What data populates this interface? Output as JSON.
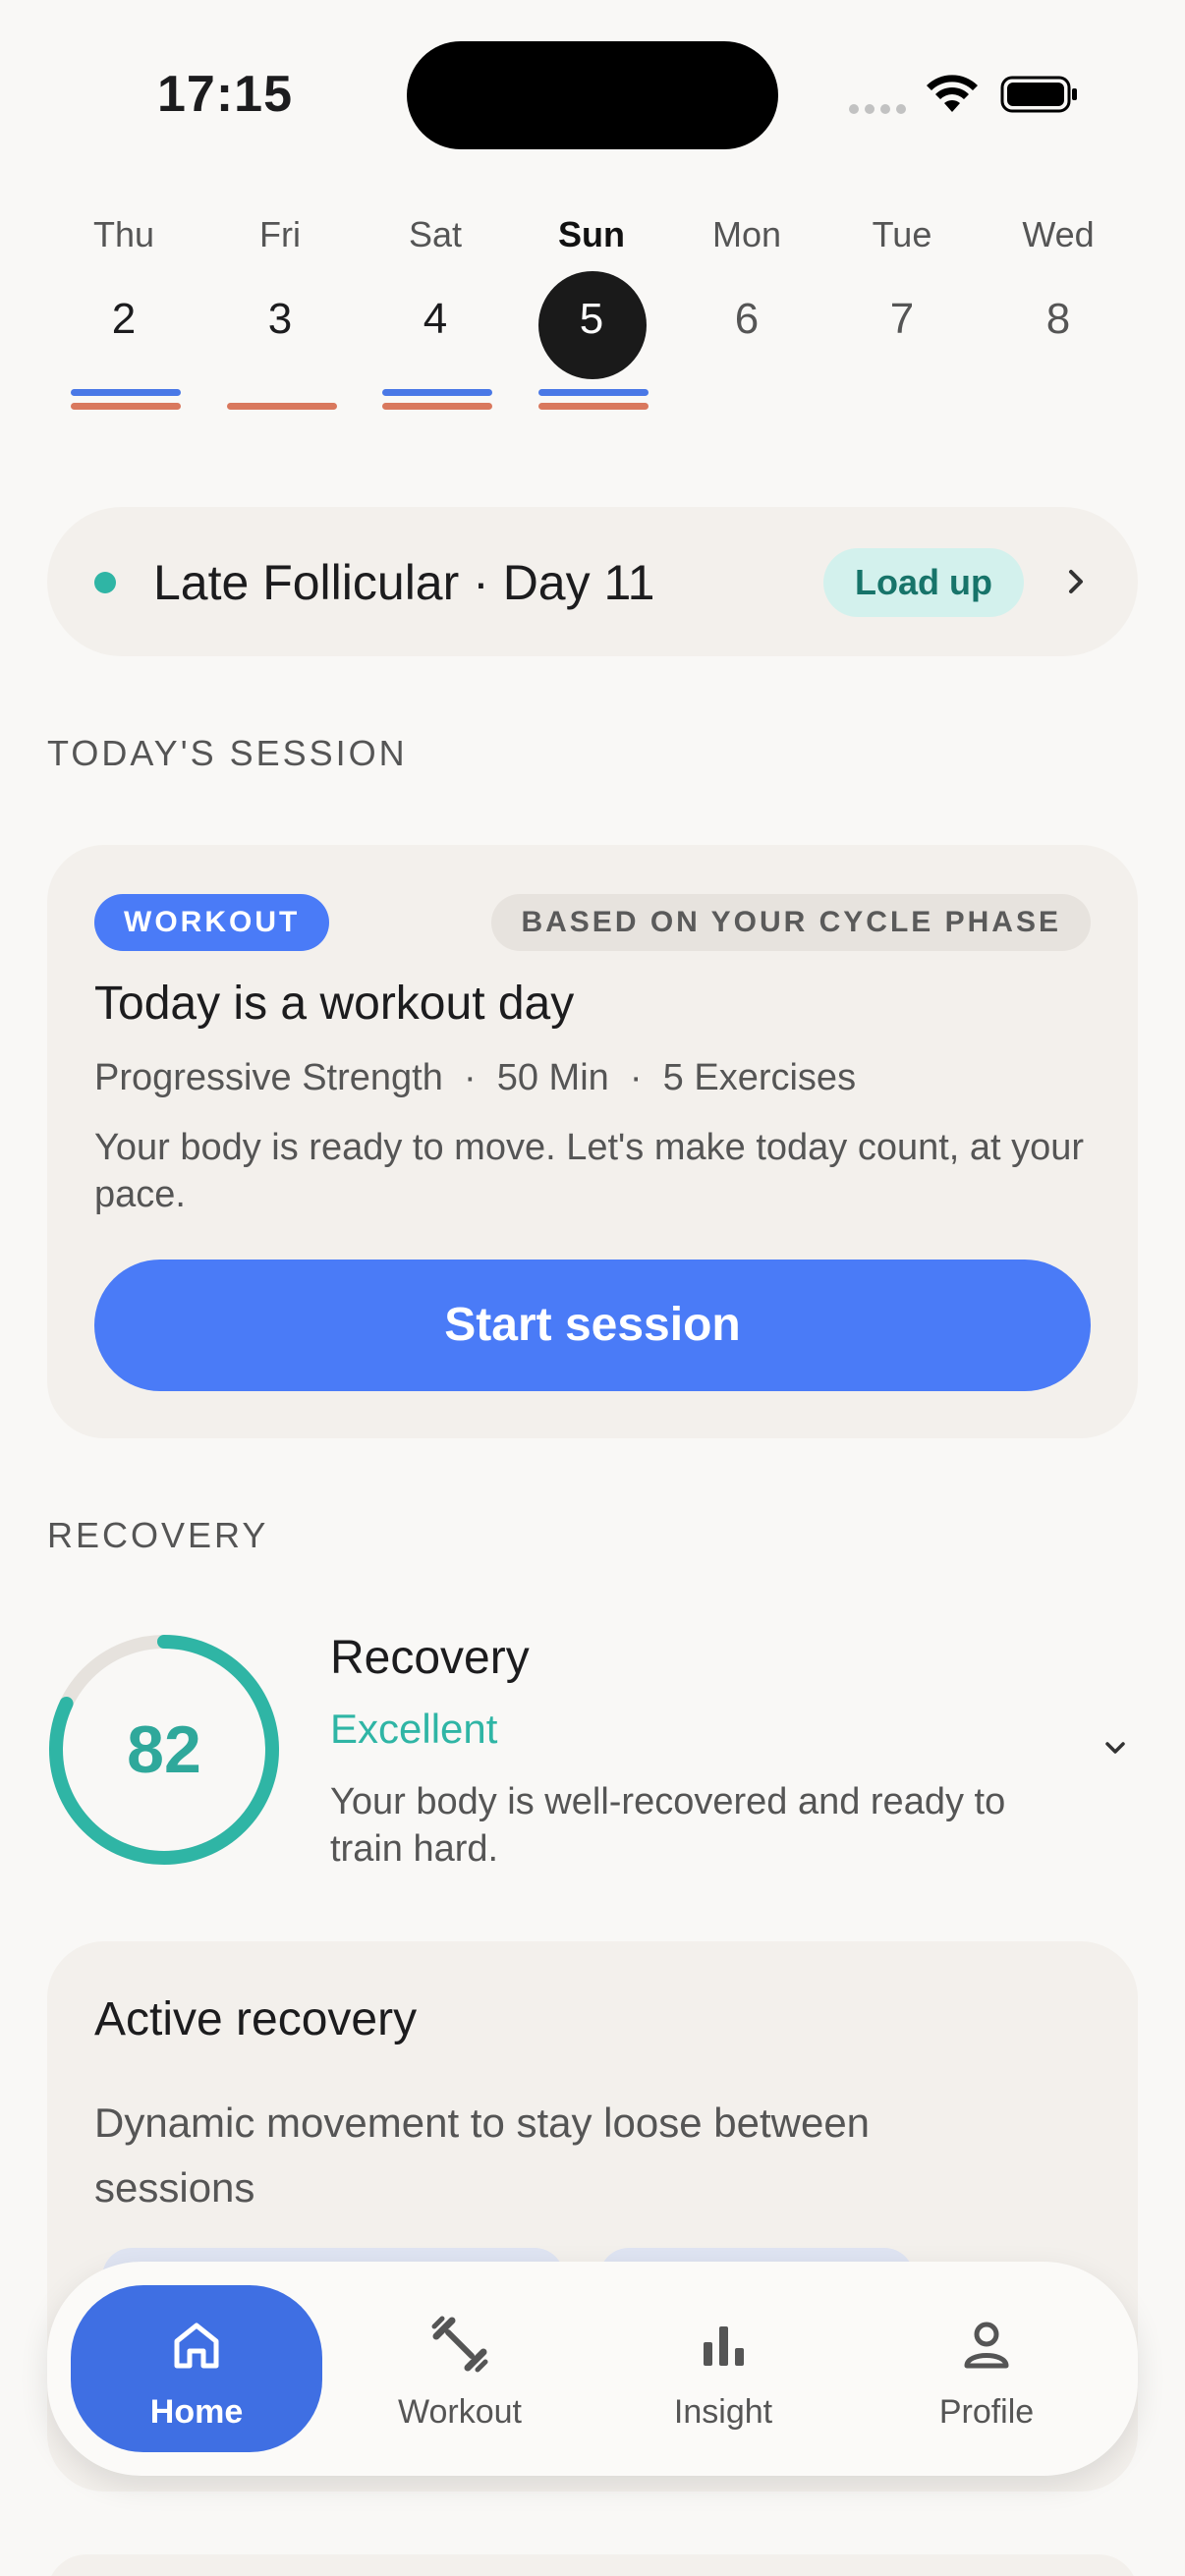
{
  "status_bar": {
    "time": "17:15"
  },
  "calendar": {
    "days": [
      {
        "name": "Thu",
        "num": "2"
      },
      {
        "name": "Fri",
        "num": "3"
      },
      {
        "name": "Sat",
        "num": "4"
      },
      {
        "name": "Sun",
        "num": "5"
      },
      {
        "name": "Mon",
        "num": "6"
      },
      {
        "name": "Tue",
        "num": "7"
      },
      {
        "name": "Wed",
        "num": "8"
      }
    ],
    "selected_day": "Sun"
  },
  "phase": {
    "label": "Late Follicular · Day 11",
    "badge": "Load up"
  },
  "session": {
    "section_label": "TODAY'S SESSION",
    "type_badge": "WORKOUT",
    "phase_badge": "BASED ON YOUR CYCLE PHASE",
    "title": "Today is a workout day",
    "meta": "Progressive Strength  ·  50 Min  ·  5 Exercises",
    "description": "Your body is ready to move. Let's make today count, at your pace.",
    "cta": "Start session"
  },
  "recovery": {
    "section_label": "RECOVERY",
    "score": "82",
    "score_fraction": 0.82,
    "title": "Recovery",
    "status": "Excellent",
    "description": "Your body is well-recovered and ready to train hard."
  },
  "active_recovery": {
    "title": "Active recovery",
    "description": "Dynamic movement to stay loose between sessions"
  },
  "nav": {
    "items": [
      {
        "label": "Home",
        "icon": "home-icon"
      },
      {
        "label": "Workout",
        "icon": "dumbbell-icon"
      },
      {
        "label": "Insight",
        "icon": "bar-chart-icon"
      },
      {
        "label": "Profile",
        "icon": "person-icon"
      }
    ],
    "active": "Home"
  },
  "colors": {
    "accent_blue": "#4a7bf7",
    "teal": "#2fb5a5",
    "orange": "#d9785d"
  }
}
